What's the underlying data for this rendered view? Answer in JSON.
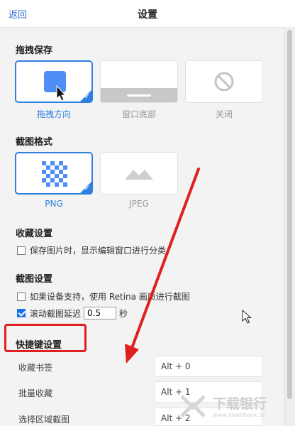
{
  "header": {
    "back_label": "返回",
    "title": "设置"
  },
  "drag_save": {
    "title": "拖拽保存",
    "options": [
      {
        "label": "拖拽方向",
        "selected": true,
        "icon": "drag-direction-icon"
      },
      {
        "label": "窗口底部",
        "selected": false,
        "icon": "window-bottom-icon"
      },
      {
        "label": "关闭",
        "selected": false,
        "icon": "disabled-icon"
      }
    ]
  },
  "format": {
    "title": "截图格式",
    "options": [
      {
        "label": "PNG",
        "selected": true,
        "icon": "png-checker-icon"
      },
      {
        "label": "JPEG",
        "selected": false,
        "icon": "jpeg-mountain-icon"
      }
    ]
  },
  "favorites": {
    "title": "收藏设置",
    "show_edit_window_label": "保存图片时，显示编辑窗口进行分类",
    "show_edit_window_checked": false
  },
  "screenshot": {
    "title": "截图设置",
    "retina_label": "如果设备支持，使用 Retina 画质进行截图",
    "retina_checked": false,
    "scroll_delay_label": "滚动截图延迟",
    "scroll_delay_value": "0.5",
    "scroll_delay_unit": "秒",
    "scroll_delay_checked": true
  },
  "shortcuts": {
    "title": "快捷键设置",
    "items": [
      {
        "label": "收藏书签",
        "keys": "Alt + 0"
      },
      {
        "label": "批量收藏",
        "keys": "Alt + 1"
      },
      {
        "label": "选择区域截图",
        "keys": "Alt + 2"
      }
    ]
  },
  "watermark": {
    "text": "下载银行",
    "subtext": "www.downbank.cn"
  },
  "colors": {
    "accent": "#2f7fe0",
    "annotation_red": "#e02020"
  }
}
